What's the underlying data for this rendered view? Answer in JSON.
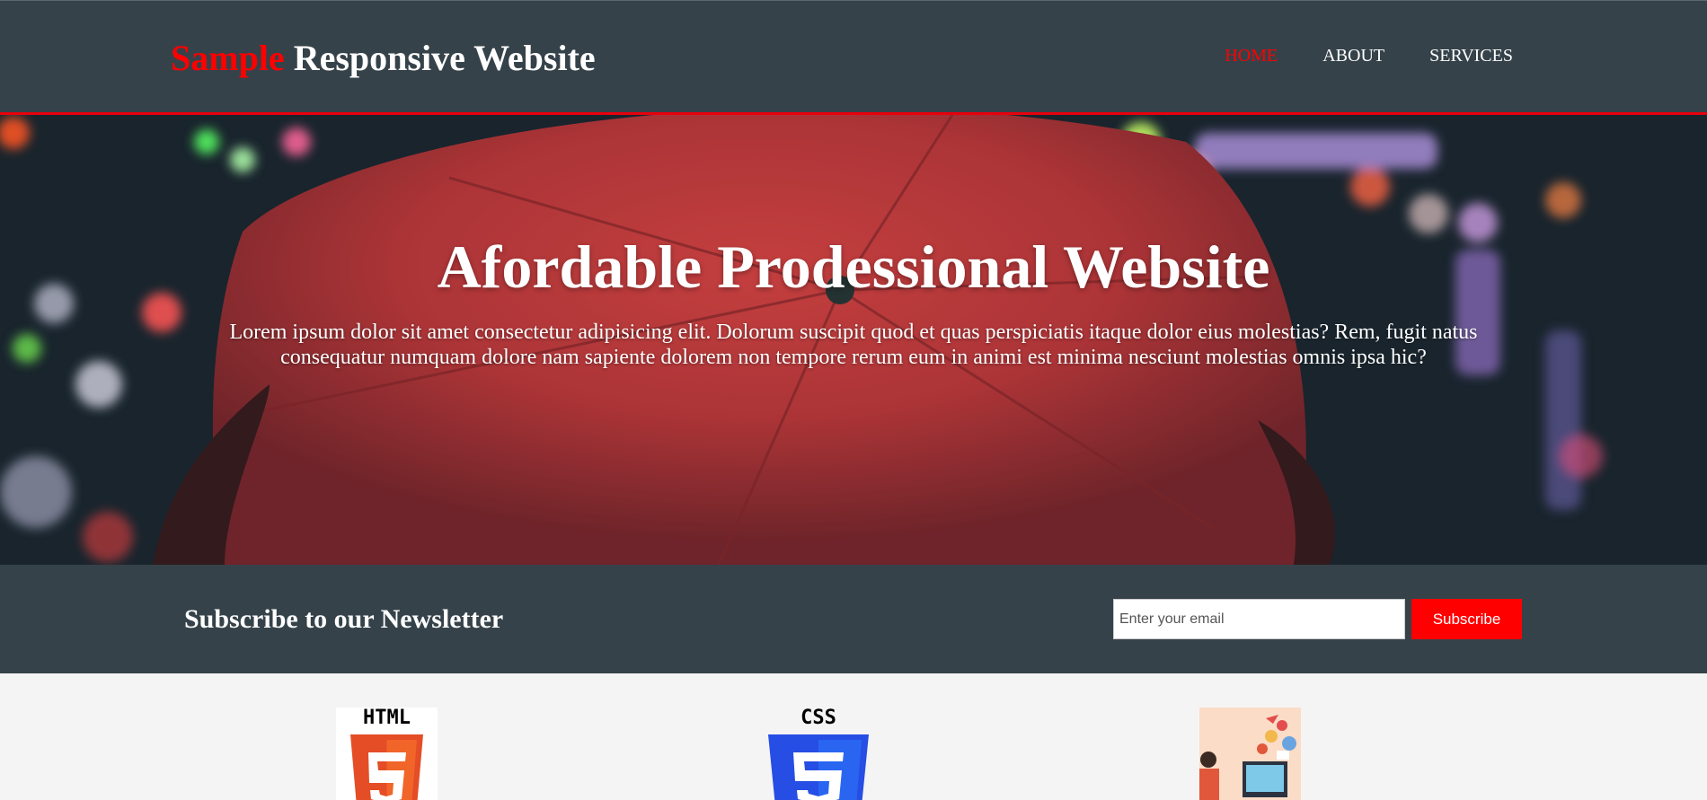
{
  "header": {
    "brand_highlight": "Sample",
    "brand_rest": "Responsive Website",
    "nav": [
      {
        "label": "HOME",
        "current": true
      },
      {
        "label": "ABOUT",
        "current": false
      },
      {
        "label": "SERVICES",
        "current": false
      }
    ]
  },
  "hero": {
    "title": "Afordable Prodessional Website",
    "text": "Lorem ipsum dolor sit amet consectetur adipisicing elit. Dolorum suscipit quod et quas perspiciatis itaque dolor eius molestias? Rem, fugit natus consequatur numquam dolore nam sapiente dolorem non tempore rerum eum in animi est minima nesciunt molestias omnis ipsa hic?",
    "background_image": "red-umbrella-night-bokeh"
  },
  "newsletter": {
    "heading": "Subscribe to our Newsletter",
    "email_placeholder": "Enter your email",
    "email_value": "",
    "button_label": "Subscribe"
  },
  "boxes": [
    {
      "icon": "html5-logo-icon",
      "label": "HTML",
      "color": "#e44d26"
    },
    {
      "icon": "css3-logo-icon",
      "label": "CSS",
      "color": "#264de4"
    },
    {
      "icon": "web-design-illustration",
      "color": "#fbdcc7"
    }
  ],
  "colors": {
    "header_bg": "#35424a",
    "accent": "#ff0000",
    "body_bg": "#f4f4f4",
    "text_light": "#ffffff"
  }
}
